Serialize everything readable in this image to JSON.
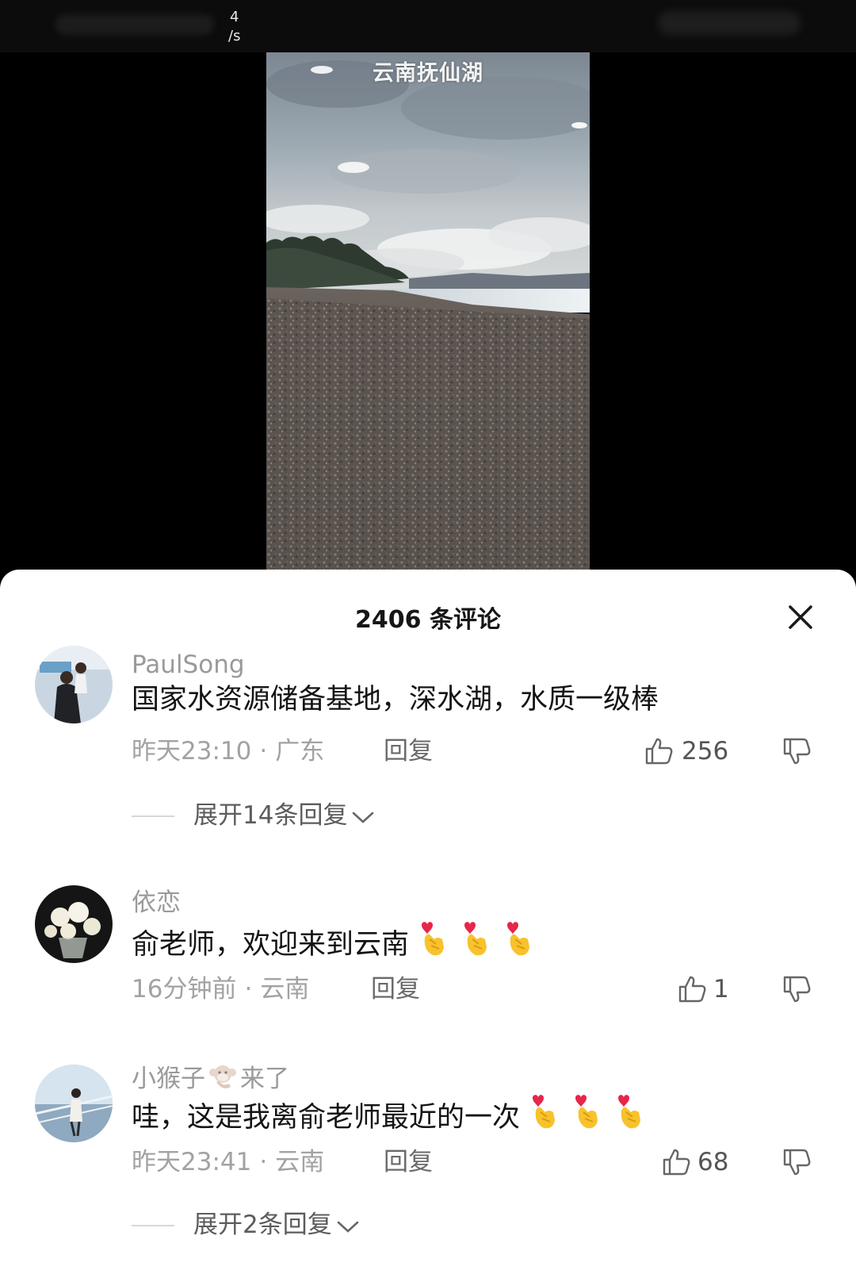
{
  "status_bar": {
    "net_speed_value": "4",
    "net_speed_unit": "/s"
  },
  "video": {
    "caption": "云南抚仙湖"
  },
  "comments_panel": {
    "title": "2406 条评论",
    "close_icon": "close-icon",
    "comments": [
      {
        "username": "PaulSong",
        "text": "国家水资源储备基地，深水湖，水质一级棒",
        "time": "昨天23:10",
        "location": "广东",
        "reply_label": "回复",
        "likes": "256",
        "expand_label": "展开14条回复"
      },
      {
        "username": "依恋",
        "text": "俞老师，欢迎来到云南",
        "emoji": "finger-heart-emoji",
        "time": "16分钟前",
        "location": "云南",
        "reply_label": "回复",
        "likes": "1"
      },
      {
        "username_prefix": "小猴子",
        "username_suffix": "来了",
        "username_icon": "monkey-emoji",
        "text": "哇，这是我离俞老师最近的一次",
        "emoji": "finger-heart-emoji",
        "time": "昨天23:41",
        "location": "云南",
        "reply_label": "回复",
        "likes": "68",
        "expand_label": "展开2条回复"
      }
    ]
  }
}
